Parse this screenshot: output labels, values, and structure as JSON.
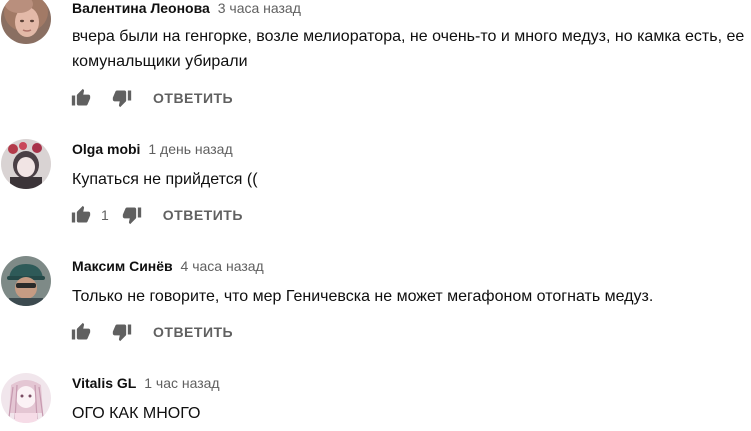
{
  "comments": [
    {
      "author": "Валентина Леонова",
      "time": "3 часа назад",
      "text": "вчера были на генгорке, возле мелиоратора, не очень-то и много медуз, но камка есть, ее комунальщики убирали",
      "likes": "",
      "reply_label": "ОТВЕТИТЬ"
    },
    {
      "author": "Olga mobi",
      "time": "1 день назад",
      "text": "Купаться не прийдется ((",
      "likes": "1",
      "reply_label": "ОТВЕТИТЬ"
    },
    {
      "author": "Максим Синёв",
      "time": "4 часа назад",
      "text": "Только не говорите, что мер Геничевска  не может мегафоном отогнать медуз.",
      "likes": "",
      "reply_label": "ОТВЕТИТЬ"
    },
    {
      "author": "Vitalis GL",
      "time": "1 час назад",
      "text": "ОГО КАК МНОГО",
      "likes": "",
      "reply_label": ""
    }
  ],
  "icons": {
    "like": "thumb-up-icon",
    "dislike": "thumb-down-icon"
  },
  "colors": {
    "author": "#0f0f0f",
    "meta": "#606060",
    "icon": "#606060"
  }
}
